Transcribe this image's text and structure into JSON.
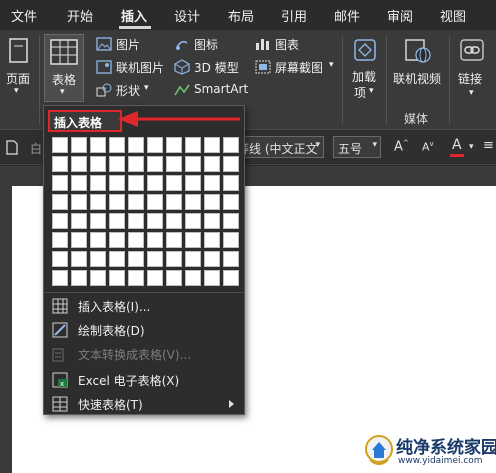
{
  "menu": {
    "tabs": [
      "文件",
      "开始",
      "插入",
      "设计",
      "布局",
      "引用",
      "邮件",
      "审阅",
      "视图"
    ],
    "active": "插入"
  },
  "ribbon": {
    "page_label": "页面",
    "table_label": "表格",
    "picture": "图片",
    "online_picture": "联机图片",
    "shapes": "形状",
    "icons": "图标",
    "model3d": "3D 模型",
    "smartart": "SmartArt",
    "chart": "图表",
    "screenshot": "屏幕截图",
    "addins": "加载",
    "addins2": "项",
    "online_video": "联机视频",
    "media_group": "媒体",
    "link": "链接"
  },
  "format": {
    "font_name": "等线 (中文正文",
    "font_size": "五号",
    "left_text": "白"
  },
  "dropdown": {
    "header": "插入表格",
    "items": [
      {
        "label": "插入表格(I)...",
        "disabled": false
      },
      {
        "label": "绘制表格(D)",
        "disabled": false
      },
      {
        "label": "文本转换成表格(V)...",
        "disabled": true
      },
      {
        "label": "Excel 电子表格(X)",
        "disabled": false
      },
      {
        "label": "快速表格(T)",
        "disabled": false
      }
    ]
  },
  "watermark": {
    "title": "纯净系统家园",
    "url": "www.yidaimei.com"
  }
}
